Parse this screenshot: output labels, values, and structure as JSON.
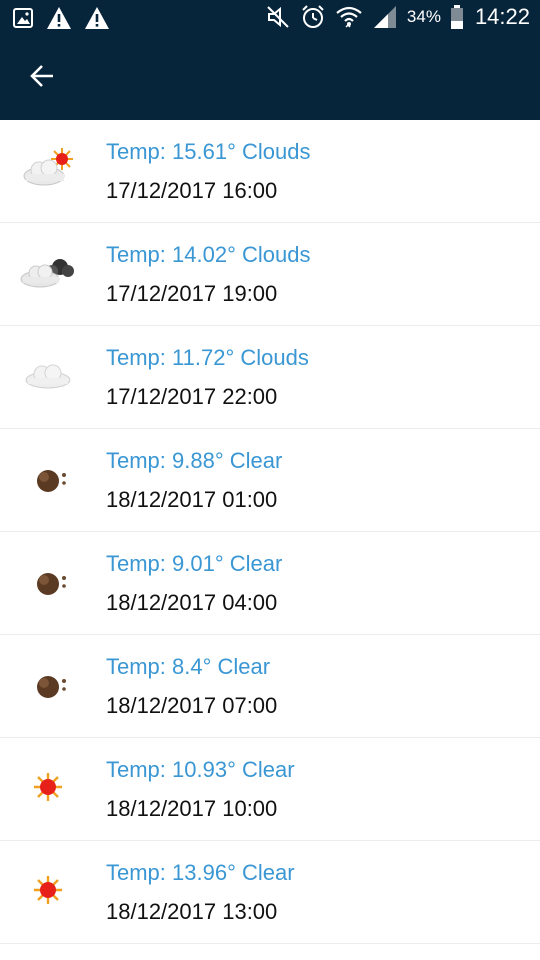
{
  "status_bar": {
    "battery": "34%",
    "time": "14:22",
    "icons_left": [
      "gallery-icon",
      "warning-icon",
      "warning-icon"
    ],
    "icons_right": [
      "mute-icon",
      "alarm-icon",
      "wifi-icon",
      "signal-icon",
      "battery-icon"
    ]
  },
  "toolbar": {
    "back_icon": "arrow-left-icon"
  },
  "colors": {
    "header_bg": "#06243a",
    "temp_text": "#3a97d4",
    "date_text": "#111111"
  },
  "forecast": [
    {
      "temp_label": "Temp: 15.61° Clouds",
      "datetime": "17/12/2017 16:00",
      "icon": "partly-cloudy-day-icon"
    },
    {
      "temp_label": "Temp: 14.02° Clouds",
      "datetime": "17/12/2017 19:00",
      "icon": "partly-cloudy-night-icon"
    },
    {
      "temp_label": "Temp: 11.72° Clouds",
      "datetime": "17/12/2017 22:00",
      "icon": "cloud-icon"
    },
    {
      "temp_label": "Temp: 9.88° Clear",
      "datetime": "18/12/2017 01:00",
      "icon": "moon-icon"
    },
    {
      "temp_label": "Temp: 9.01° Clear",
      "datetime": "18/12/2017 04:00",
      "icon": "moon-icon"
    },
    {
      "temp_label": "Temp: 8.4° Clear",
      "datetime": "18/12/2017 07:00",
      "icon": "moon-icon"
    },
    {
      "temp_label": "Temp: 10.93° Clear",
      "datetime": "18/12/2017 10:00",
      "icon": "sun-icon"
    },
    {
      "temp_label": "Temp: 13.96° Clear",
      "datetime": "18/12/2017 13:00",
      "icon": "sun-icon"
    }
  ]
}
